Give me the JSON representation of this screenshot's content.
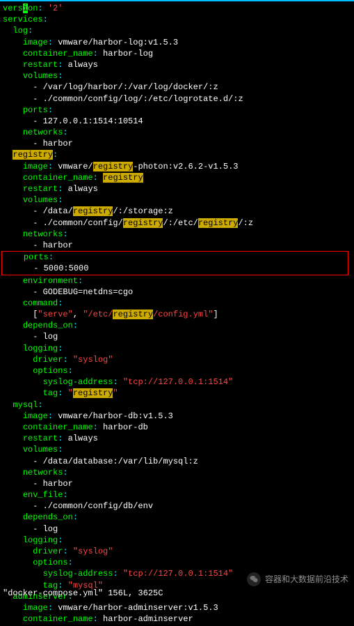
{
  "version_key": "vers",
  "version_key_cursor": "i",
  "version_key_end": "on",
  "version_val": "'2'",
  "services_key": "services",
  "log": {
    "name": "log",
    "image_key": "image",
    "image_val": "vmware/harbor-log:v1.5.3",
    "cname_key": "container_name",
    "cname_val": "harbor-log",
    "restart_key": "restart",
    "restart_val": "always",
    "volumes_key": "volumes",
    "vol1": "/var/log/harbor/:/var/log/docker/:z",
    "vol2": "./common/config/log/:/etc/logrotate.d/:z",
    "ports_key": "ports",
    "port1": "127.0.0.1:1514:10514",
    "networks_key": "networks",
    "net1": "harbor"
  },
  "registry": {
    "name": "registry",
    "image_key": "image",
    "image_pre": "vmware/",
    "image_hl": "registry",
    "image_post": "-photon:v2.6.2-v1.5.3",
    "cname_key": "container_name",
    "cname_hl": "registry",
    "restart_key": "restart",
    "restart_val": "always",
    "volumes_key": "volumes",
    "vol1_pre": "/data/",
    "vol1_hl": "registry",
    "vol1_post": "/:/storage:z",
    "vol2_pre": "./common/config/",
    "vol2_hl1": "registry",
    "vol2_mid": "/:/etc/",
    "vol2_hl2": "registry",
    "vol2_post": "/:z",
    "networks_key": "networks",
    "net1": "harbor",
    "ports_key": "ports",
    "port1": "5000:5000",
    "env_key": "environment",
    "env1": "GODEBUG=netdns=cgo",
    "command_key": "command",
    "cmd_open": "[",
    "cmd_serve": "\"serve\"",
    "cmd_comma": ", ",
    "cmd_path_pre": "\"/etc/",
    "cmd_path_hl": "registry",
    "cmd_path_post": "/config.yml\"",
    "cmd_close": "]",
    "depends_key": "depends_on",
    "dep1": "log",
    "logging_key": "logging",
    "driver_key": "driver",
    "driver_val": "\"syslog\"",
    "options_key": "options",
    "syslog_addr_key": "syslog-address",
    "syslog_addr_val": "\"tcp://127.0.0.1:1514\"",
    "tag_key": "tag",
    "tag_pre": "\"",
    "tag_hl": "registry",
    "tag_post": "\""
  },
  "mysql": {
    "name": "mysql",
    "image_key": "image",
    "image_val": "vmware/harbor-db:v1.5.3",
    "cname_key": "container_name",
    "cname_val": "harbor-db",
    "restart_key": "restart",
    "restart_val": "always",
    "volumes_key": "volumes",
    "vol1": "/data/database:/var/lib/mysql:z",
    "networks_key": "networks",
    "net1": "harbor",
    "envfile_key": "env_file",
    "envfile1": "./common/config/db/env",
    "depends_key": "depends_on",
    "dep1": "log",
    "logging_key": "logging",
    "driver_key": "driver",
    "driver_val": "\"syslog\"",
    "options_key": "options",
    "syslog_addr_key": "syslog-address",
    "syslog_addr_val": "\"tcp://127.0.0.1:1514\"",
    "tag_key": "tag",
    "tag_val": "\"mysql\""
  },
  "adminserver": {
    "name": "adminserver",
    "image_key": "image",
    "image_val": "vmware/harbor-adminserver:v1.5.3",
    "cname_key": "container_name",
    "cname_val": "harbor-adminserver"
  },
  "status": "\"docker-compose.yml\" 156L, 3625C",
  "watermark": "容器和大数据前沿技术"
}
